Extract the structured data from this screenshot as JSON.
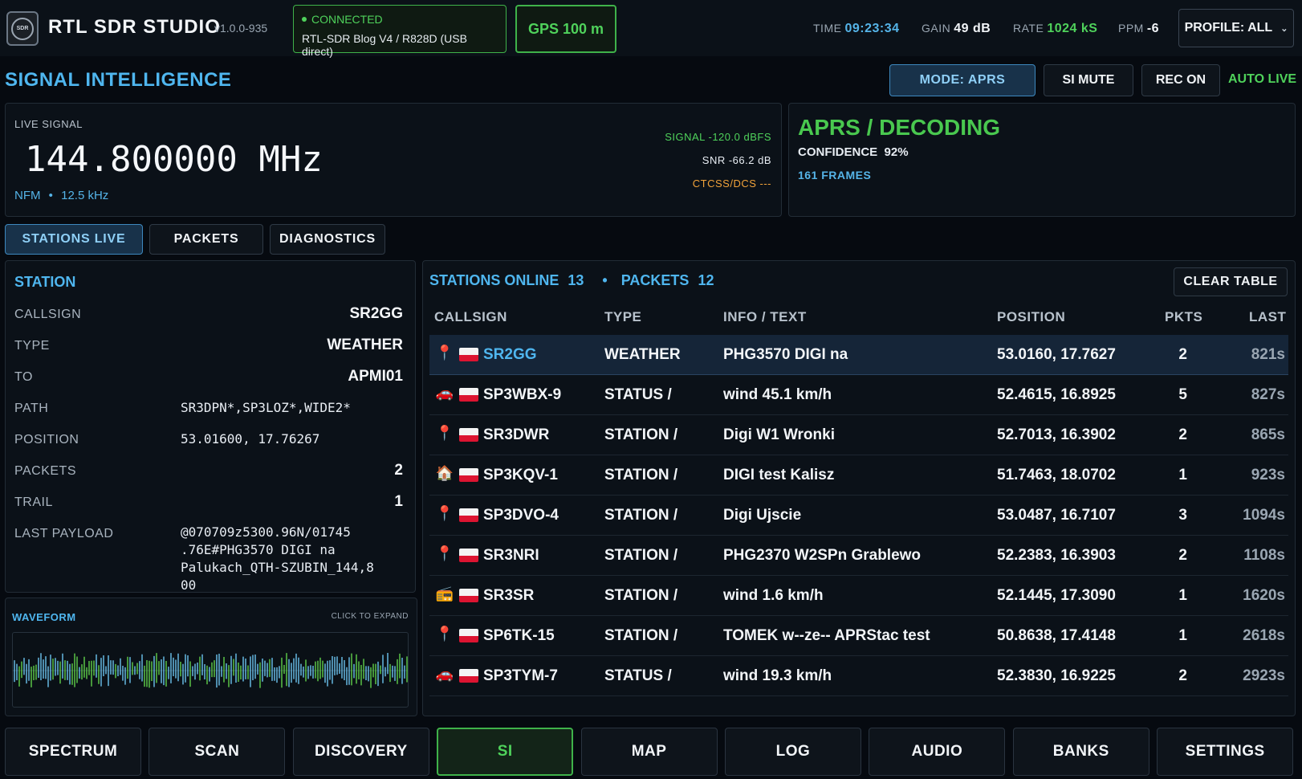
{
  "app": {
    "title": "RTL SDR STUDIO",
    "version": "v1.0.0-935",
    "logo_icon": "rtl-sdr-logo-icon"
  },
  "connection": {
    "status": "CONNECTED",
    "device": "RTL-SDR Blog V4 / R828D (USB direct)"
  },
  "gps": {
    "label": "GPS 100 m"
  },
  "stats": {
    "time_label": "TIME",
    "time_value": "09:23:34",
    "gain_label": "GAIN",
    "gain_value": "49 dB",
    "rate_label": "RATE",
    "rate_value": "1024 kS",
    "ppm_label": "PPM",
    "ppm_value": "-6"
  },
  "profile": {
    "label": "PROFILE: ALL",
    "icon": "chevron-down-icon"
  },
  "section": {
    "title": "SIGNAL INTELLIGENCE"
  },
  "header_buttons": {
    "mode": "MODE: APRS",
    "si_mute": "SI MUTE",
    "rec": "REC ON",
    "auto_live": "AUTO LIVE"
  },
  "live_signal": {
    "label": "LIVE SIGNAL",
    "frequency": "144.800000 MHz",
    "modulation": "NFM",
    "bandwidth": "12.5 kHz",
    "signal": "SIGNAL  -120.0 dBFS",
    "snr": "SNR -66.2 dB",
    "ctcss": "CTCSS/DCS ---"
  },
  "decoder": {
    "title": "APRS / DECODING",
    "confidence_label": "CONFIDENCE",
    "confidence_value": "92%",
    "frames": "161 FRAMES"
  },
  "tabs": [
    {
      "label": "STATIONS LIVE"
    },
    {
      "label": "PACKETS"
    },
    {
      "label": "DIAGNOSTICS"
    }
  ],
  "station": {
    "title": "STATION",
    "fields": {
      "callsign": {
        "key": "CALLSIGN",
        "value": "SR2GG"
      },
      "type": {
        "key": "TYPE",
        "value": "WEATHER"
      },
      "to": {
        "key": "TO",
        "value": "APMI01"
      },
      "path": {
        "key": "PATH",
        "value": "SR3DPN*,SP3LOZ*,WIDE2*"
      },
      "position": {
        "key": "POSITION",
        "value": "53.01600, 17.76267"
      },
      "packets": {
        "key": "PACKETS",
        "value": "2"
      },
      "trail": {
        "key": "TRAIL",
        "value": "1"
      },
      "payload": {
        "key": "LAST PAYLOAD",
        "line1": "@070709z5300.96N/01745",
        "line2": ".76E#PHG3570 DIGI na",
        "line3": "Palukach_QTH-SZUBIN_144,8",
        "line4": "00"
      }
    }
  },
  "waveform": {
    "title": "WAVEFORM",
    "hint": "CLICK TO EXPAND"
  },
  "table": {
    "online_label": "STATIONS ONLINE",
    "online_count": "13",
    "packets_label": "PACKETS",
    "packets_count": "12",
    "clear_label": "CLEAR TABLE",
    "columns": [
      "CALLSIGN",
      "TYPE",
      "INFO / TEXT",
      "POSITION",
      "PKTS",
      "LAST"
    ],
    "rows": [
      {
        "icon": "pin-icon",
        "callsign": "SR2GG",
        "type": "WEATHER",
        "info": "PHG3570 DIGI na",
        "position": "53.0160, 17.7627",
        "pkts": "2",
        "last": "821s"
      },
      {
        "icon": "car-icon",
        "callsign": "SP3WBX-9",
        "type": "STATUS /",
        "info": "wind 45.1 km/h",
        "position": "52.4615, 16.8925",
        "pkts": "5",
        "last": "827s"
      },
      {
        "icon": "pin-icon",
        "callsign": "SR3DWR",
        "type": "STATION /",
        "info": "Digi W1 Wronki",
        "position": "52.7013, 16.3902",
        "pkts": "2",
        "last": "865s"
      },
      {
        "icon": "house-icon",
        "callsign": "SP3KQV-1",
        "type": "STATION /",
        "info": "DIGI test Kalisz",
        "position": "51.7463, 18.0702",
        "pkts": "1",
        "last": "923s"
      },
      {
        "icon": "pin-icon",
        "callsign": "SP3DVO-4",
        "type": "STATION /",
        "info": "Digi Ujscie",
        "position": "53.0487, 16.7107",
        "pkts": "3",
        "last": "1094s"
      },
      {
        "icon": "pin-icon",
        "callsign": "SR3NRI",
        "type": "STATION /",
        "info": "PHG2370 W2SPn Grablewo",
        "position": "52.2383, 16.3903",
        "pkts": "2",
        "last": "1108s"
      },
      {
        "icon": "radio-icon",
        "callsign": "SR3SR",
        "type": "STATION /",
        "info": "wind 1.6 km/h",
        "position": "52.1445, 17.3090",
        "pkts": "1",
        "last": "1620s"
      },
      {
        "icon": "pin-icon",
        "callsign": "SP6TK-15",
        "type": "STATION /",
        "info": "TOMEK w--ze-- APRStac test",
        "position": "50.8638, 17.4148",
        "pkts": "1",
        "last": "2618s"
      },
      {
        "icon": "car-icon",
        "callsign": "SP3TYM-7",
        "type": "STATUS /",
        "info": "wind 19.3 km/h",
        "position": "52.3830, 16.9225",
        "pkts": "2",
        "last": "2923s"
      }
    ]
  },
  "nav": [
    "SPECTRUM",
    "SCAN",
    "DISCOVERY",
    "SI",
    "MAP",
    "LOG",
    "AUDIO",
    "BANKS",
    "SETTINGS"
  ],
  "colors": {
    "accent_blue": "#4fb6ef",
    "accent_green": "#4fd25b",
    "ctcss_orange": "#f0a23a",
    "background": "#060a10"
  }
}
